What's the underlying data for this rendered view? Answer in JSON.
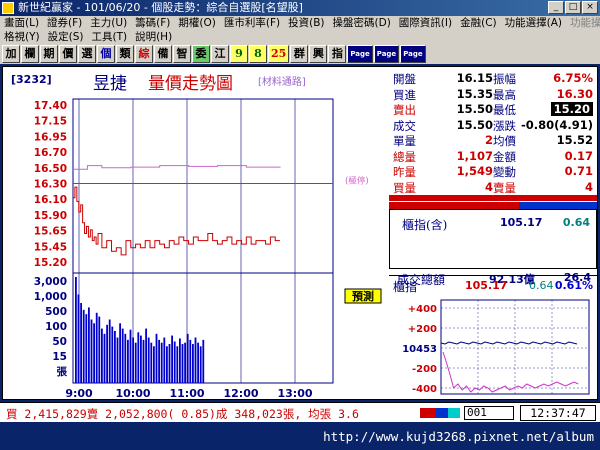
{
  "window": {
    "title": "新世紀贏家 - 101/06/20 - 個股走勢：綜合自選股[名望股]"
  },
  "menu1": [
    "畫面(L)",
    "證券(F)",
    "主力(U)",
    "籌碼(F)",
    "期權(O)",
    "匯市利率(F)",
    "投資(B)",
    "操盤密碼(D)",
    "國際資訊(I)",
    "金融(C)",
    "功能選擇(A)",
    "功能操作(F)"
  ],
  "menu2": [
    "格視(Y)",
    "設定(S)",
    "工具(T)",
    "說明(H)"
  ],
  "toolbar": [
    "加",
    "欄",
    "期",
    "價",
    "選",
    "個",
    "類",
    "綜",
    "備",
    "智",
    "委",
    "江",
    "9",
    "8",
    "25",
    "群",
    "興",
    "指",
    "Page",
    "Page",
    "Page"
  ],
  "stock": {
    "code": "[3232]",
    "name": "昱捷",
    "chart_title": "量價走勢圖",
    "sector": "[材料通路]"
  },
  "quote": [
    {
      "l1": "開盤",
      "v1": "16.15",
      "l2": "振幅",
      "v2": "6.75%"
    },
    {
      "l1": "買進",
      "v1": "15.35",
      "l2": "最高",
      "v2": "16.30"
    },
    {
      "l1": "賣出",
      "v1": "15.50",
      "l2": "最低",
      "v2": "15.20"
    },
    {
      "l1": "成交",
      "v1": "15.50",
      "l2": "漲跌",
      "v2": "-0.80(4.91)"
    },
    {
      "l1": "單量",
      "v1": "2",
      "l2": "均價",
      "v2": "15.52"
    },
    {
      "l1": "總量",
      "v1": "1,107",
      "l2": "金額",
      "v2": "0.17"
    },
    {
      "l1": "昨量",
      "v1": "1,549",
      "l2": "變動",
      "v2": "0.71"
    },
    {
      "l1": "買量",
      "v1": "4",
      "l2": "賣量",
      "v2": "4"
    }
  ],
  "index": {
    "label": "櫃指(含)",
    "value": "105.17",
    "change": "0.64"
  },
  "volume_total": {
    "label": "成交總額",
    "value": "92.13億",
    "change": "26.4"
  },
  "mini": {
    "label": "櫃指",
    "value": "105.17",
    "change": "0.64",
    "pct": "0.61%",
    "yticks": [
      "+400",
      "+200",
      "10453",
      "-200",
      "-400"
    ]
  },
  "limit_label": "(極停)",
  "warning_label": "預測",
  "status": {
    "text": "買 2,415,829賣 2,052,800( 0.85)成 348,023張, 均張 3.6",
    "code": "001",
    "time": "12:37:47"
  },
  "watermark": "http://www.kujd3268.pixnet.net/album",
  "chart_data": {
    "type": "line",
    "price_ticks": [
      "17.40",
      "17.15",
      "16.95",
      "16.70",
      "16.50",
      "16.30",
      "16.10",
      "15.90",
      "15.65",
      "15.45",
      "15.20"
    ],
    "volume_ticks": [
      "3,000",
      "1,000",
      "500",
      "100",
      "50",
      "15",
      "張"
    ],
    "x_ticks": [
      "9:00",
      "10:00",
      "11:00",
      "12:00",
      "13:00"
    ],
    "ref_price": 16.3,
    "limit_up": 16.95,
    "series": [
      {
        "color": "#cc0000",
        "x": [
          0,
          2,
          4,
          6,
          8,
          10,
          12,
          14,
          16,
          18,
          20,
          22,
          24,
          26,
          30,
          35,
          40,
          45,
          50,
          55,
          60,
          65,
          70,
          75,
          80,
          85,
          90,
          95,
          100,
          105,
          110,
          115,
          120,
          125,
          130,
          135,
          140,
          145,
          150,
          155,
          160,
          165,
          170,
          175,
          180,
          185,
          190,
          195,
          200,
          205,
          210,
          215
        ],
        "y": [
          16.1,
          16.25,
          16.05,
          15.9,
          16.0,
          15.75,
          15.6,
          15.7,
          15.55,
          15.65,
          15.5,
          15.55,
          15.45,
          15.6,
          15.4,
          15.5,
          15.35,
          15.4,
          15.3,
          15.5,
          15.4,
          15.45,
          15.4,
          15.5,
          15.4,
          15.5,
          15.45,
          15.4,
          15.5,
          15.45,
          15.55,
          15.5,
          15.45,
          15.55,
          15.5,
          15.5,
          15.6,
          15.5,
          15.45,
          15.5,
          15.55,
          15.45,
          15.5,
          15.45,
          15.55,
          15.45,
          15.5,
          15.5,
          15.45,
          15.55,
          15.5,
          15.5
        ]
      },
      {
        "color": "#cc66cc",
        "x": [
          0,
          15,
          30,
          60,
          90,
          120,
          150,
          180,
          215
        ],
        "y": [
          16.5,
          16.55,
          16.52,
          16.53,
          16.55,
          16.54,
          16.55,
          16.53,
          16.52
        ]
      }
    ],
    "volume": [
      3000,
      800,
      420,
      250,
      180,
      300,
      120,
      90,
      200,
      150,
      60,
      40,
      80,
      120,
      70,
      50,
      30,
      90,
      60,
      40,
      25,
      55,
      30,
      20,
      45,
      35,
      25,
      60,
      30,
      20,
      15,
      40,
      25,
      20,
      30,
      15,
      18,
      35,
      22,
      15,
      28,
      18,
      20,
      40,
      25,
      18,
      30,
      20,
      15,
      25
    ],
    "ylim": [
      15.2,
      17.4
    ],
    "xlim": [
      0,
      270
    ]
  }
}
